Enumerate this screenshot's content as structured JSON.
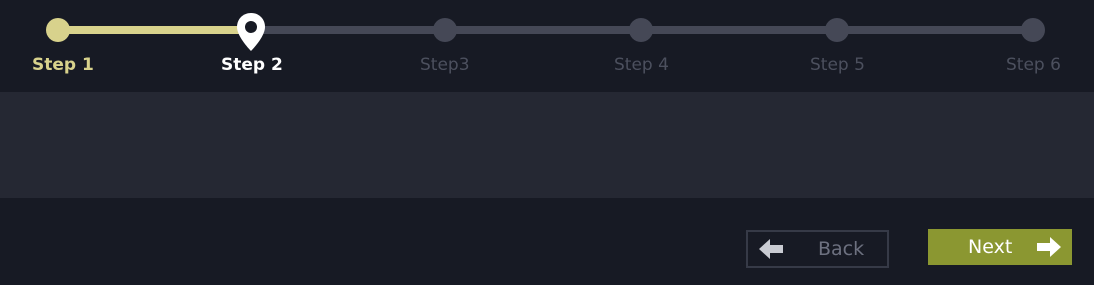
{
  "stepper": {
    "current_step": 2,
    "steps": [
      {
        "label": "Step 1",
        "state": "done"
      },
      {
        "label": "Step 2",
        "state": "current"
      },
      {
        "label": "Step3",
        "state": "upcoming"
      },
      {
        "label": "Step 4",
        "state": "upcoming"
      },
      {
        "label": "Step 5",
        "state": "upcoming"
      },
      {
        "label": "Step 6",
        "state": "upcoming"
      }
    ],
    "colors": {
      "done": "#d8d28c",
      "current": "#ffffff",
      "upcoming": "#454856"
    }
  },
  "content": {},
  "nav": {
    "back_label": "Back",
    "back_icon": "arrow-left-icon",
    "next_label": "Next",
    "next_icon": "arrow-right-icon",
    "next_color": "#8b9731"
  }
}
